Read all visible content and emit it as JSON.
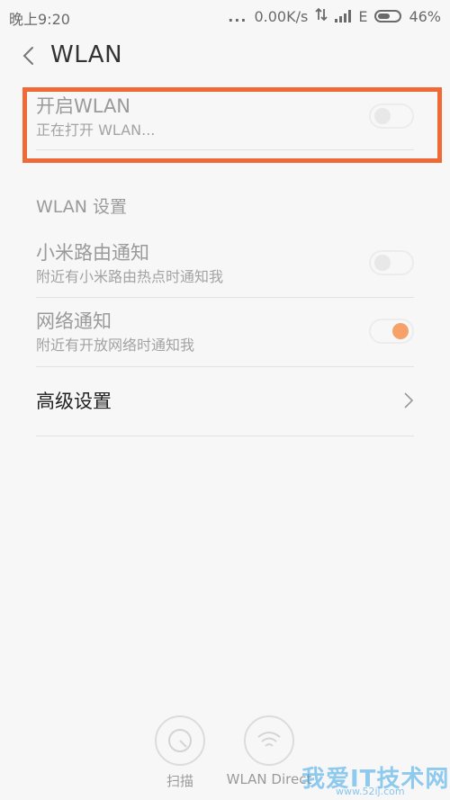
{
  "status_bar": {
    "time": "晚上9:20",
    "dots": "...",
    "speed": "0.00K/s",
    "network_type": "E",
    "battery": "46%"
  },
  "header": {
    "title": "WLAN"
  },
  "wlan_toggle": {
    "title": "开启WLAN",
    "subtitle": "正在打开 WLAN...",
    "state": "off"
  },
  "settings_section": {
    "header": "WLAN 设置",
    "items": [
      {
        "title": "小米路由通知",
        "subtitle": "附近有小米路由热点时通知我",
        "state": "off"
      },
      {
        "title": "网络通知",
        "subtitle": "附近有开放网络时通知我",
        "state": "on"
      }
    ],
    "advanced_label": "高级设置"
  },
  "bottom_actions": {
    "scan_label": "扫描",
    "direct_label": "WLAN Direct"
  },
  "watermark": {
    "text": "我爱IT技术网",
    "url": "www.52ij.com"
  },
  "colors": {
    "highlight": "#ef6a37",
    "toggle_on": "#f6a06a",
    "watermark": "#3aa4e8"
  }
}
